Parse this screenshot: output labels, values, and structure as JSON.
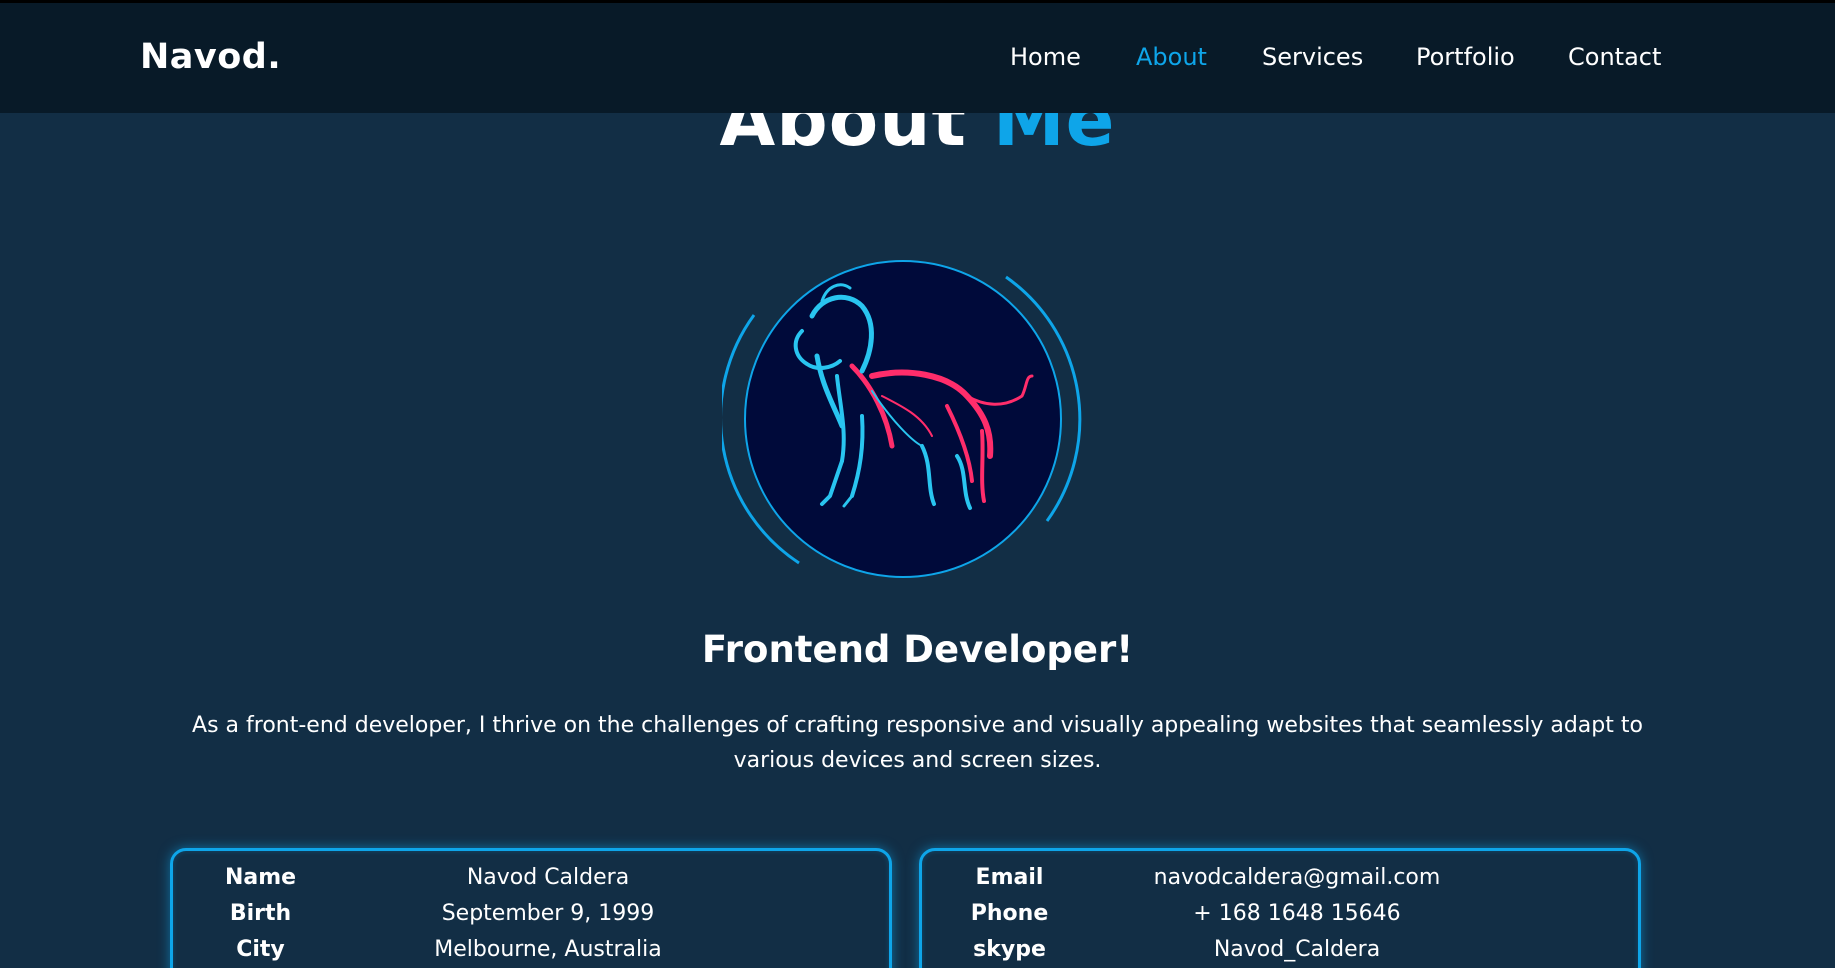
{
  "header": {
    "logo": "Navod.",
    "nav": [
      {
        "label": "Home",
        "active": false
      },
      {
        "label": "About",
        "active": true
      },
      {
        "label": "Services",
        "active": false
      },
      {
        "label": "Portfolio",
        "active": false
      },
      {
        "label": "Contact",
        "active": false
      }
    ]
  },
  "about": {
    "title_main": "About",
    "title_accent": "Me",
    "avatar_icon": "lion-illustration",
    "role": "Frontend Developer!",
    "intro": "As a front-end developer, I thrive on the challenges of crafting responsive and visually appealing websites that seamlessly adapt to various devices and screen sizes."
  },
  "info_left": [
    {
      "label": "Name",
      "value": "Navod Caldera"
    },
    {
      "label": "Birth",
      "value": "September 9, 1999"
    },
    {
      "label": "City",
      "value": "Melbourne, Australia"
    }
  ],
  "info_right": [
    {
      "label": "Email",
      "value": "navodcaldera@gmail.com"
    },
    {
      "label": "Phone",
      "value": "+ 168 1648 15646"
    },
    {
      "label": "skype",
      "value": "Navod_Caldera"
    }
  ],
  "colors": {
    "background": "#122e45",
    "header": "#081a28",
    "accent": "#0ea5e9",
    "avatar_bg": "#000a3a",
    "lion_pink": "#ff2d6b",
    "lion_cyan": "#29c5f0"
  }
}
